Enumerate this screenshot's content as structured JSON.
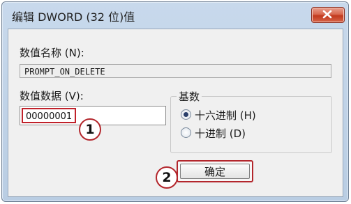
{
  "dialog": {
    "title": "编辑 DWORD (32 位)值",
    "close_icon": "close-icon"
  },
  "value_name": {
    "label": "数值名称 (N):",
    "value": "PROMPT_ON_DELETE"
  },
  "value_data": {
    "label": "数值数据 (V):",
    "value": "00000001"
  },
  "base": {
    "title": "基数",
    "options": [
      {
        "label": "十六进制 (H)",
        "checked": true
      },
      {
        "label": "十进制 (D)",
        "checked": false
      }
    ]
  },
  "buttons": {
    "ok_label": "确定"
  },
  "callouts": [
    "1",
    "2"
  ],
  "colors": {
    "highlight": "#c0212a",
    "titlebar": "#c8d9ec"
  }
}
